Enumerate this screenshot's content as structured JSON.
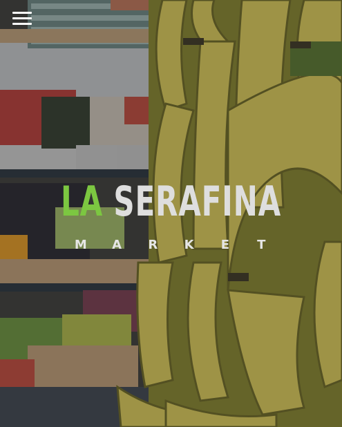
{
  "header": {
    "menu_icon": "hamburger-menu-icon"
  },
  "brand": {
    "title_part1": "LA",
    "title_part2": "SERAFINA",
    "subtitle_letters": [
      "M",
      "A",
      "R",
      "K",
      "E",
      "T"
    ]
  },
  "colors": {
    "accent": "#7cc741",
    "title": "#dedede",
    "subtitle": "#e6e6e6"
  }
}
